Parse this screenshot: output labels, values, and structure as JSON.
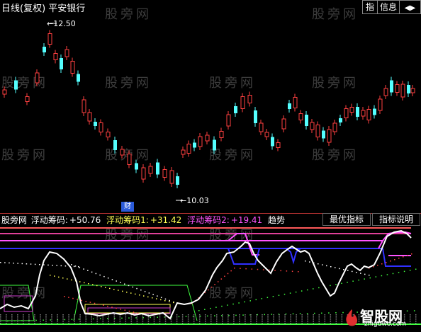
{
  "header": {
    "title": "日线(复权) 平安银行",
    "btn_indicator": "指",
    "btn_info": "信息",
    "btn_nav_left": "◀",
    "btn_nav_right": "▶"
  },
  "price_chart": {
    "high_label": "12.50",
    "low_label": "10.03",
    "cai_badge": "财",
    "up_color": "#ff4040",
    "down_color": "#54ffff"
  },
  "indicator": {
    "name": "股旁网",
    "line0_label": "浮动筹码:",
    "line0_value": "+50.76",
    "line1_label": "浮动筹码1:",
    "line1_value": "+31.42",
    "line2_label": "浮动筹码2:",
    "line2_value": "+19.41",
    "trend_label": "趋势",
    "btn_best": "最优指标",
    "btn_explain": "指标说明"
  },
  "watermark": "股旁网",
  "logo": {
    "text": "智股网",
    "url": "zhiguwo.com"
  }
}
